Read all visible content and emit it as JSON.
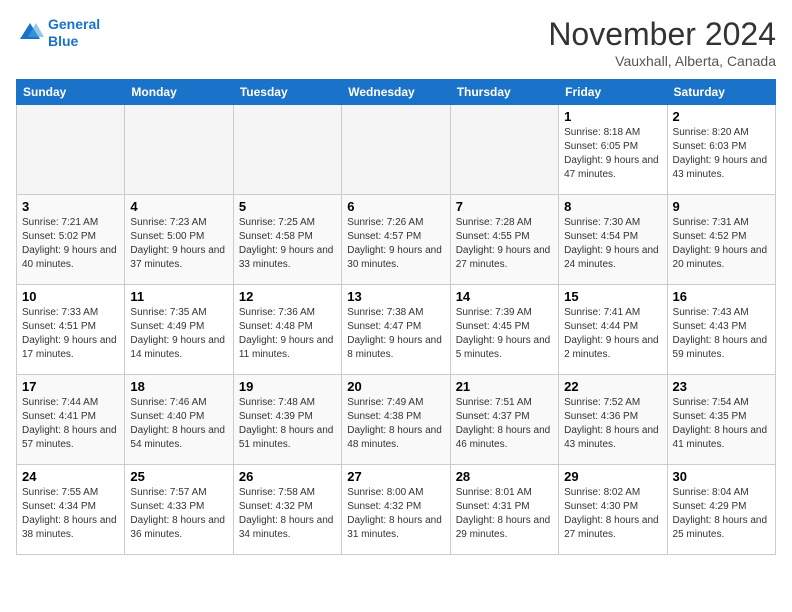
{
  "logo": {
    "line1": "General",
    "line2": "Blue"
  },
  "title": "November 2024",
  "location": "Vauxhall, Alberta, Canada",
  "days_header": [
    "Sunday",
    "Monday",
    "Tuesday",
    "Wednesday",
    "Thursday",
    "Friday",
    "Saturday"
  ],
  "weeks": [
    [
      {
        "day": "",
        "info": ""
      },
      {
        "day": "",
        "info": ""
      },
      {
        "day": "",
        "info": ""
      },
      {
        "day": "",
        "info": ""
      },
      {
        "day": "",
        "info": ""
      },
      {
        "day": "1",
        "info": "Sunrise: 8:18 AM\nSunset: 6:05 PM\nDaylight: 9 hours and 47 minutes."
      },
      {
        "day": "2",
        "info": "Sunrise: 8:20 AM\nSunset: 6:03 PM\nDaylight: 9 hours and 43 minutes."
      }
    ],
    [
      {
        "day": "3",
        "info": "Sunrise: 7:21 AM\nSunset: 5:02 PM\nDaylight: 9 hours and 40 minutes."
      },
      {
        "day": "4",
        "info": "Sunrise: 7:23 AM\nSunset: 5:00 PM\nDaylight: 9 hours and 37 minutes."
      },
      {
        "day": "5",
        "info": "Sunrise: 7:25 AM\nSunset: 4:58 PM\nDaylight: 9 hours and 33 minutes."
      },
      {
        "day": "6",
        "info": "Sunrise: 7:26 AM\nSunset: 4:57 PM\nDaylight: 9 hours and 30 minutes."
      },
      {
        "day": "7",
        "info": "Sunrise: 7:28 AM\nSunset: 4:55 PM\nDaylight: 9 hours and 27 minutes."
      },
      {
        "day": "8",
        "info": "Sunrise: 7:30 AM\nSunset: 4:54 PM\nDaylight: 9 hours and 24 minutes."
      },
      {
        "day": "9",
        "info": "Sunrise: 7:31 AM\nSunset: 4:52 PM\nDaylight: 9 hours and 20 minutes."
      }
    ],
    [
      {
        "day": "10",
        "info": "Sunrise: 7:33 AM\nSunset: 4:51 PM\nDaylight: 9 hours and 17 minutes."
      },
      {
        "day": "11",
        "info": "Sunrise: 7:35 AM\nSunset: 4:49 PM\nDaylight: 9 hours and 14 minutes."
      },
      {
        "day": "12",
        "info": "Sunrise: 7:36 AM\nSunset: 4:48 PM\nDaylight: 9 hours and 11 minutes."
      },
      {
        "day": "13",
        "info": "Sunrise: 7:38 AM\nSunset: 4:47 PM\nDaylight: 9 hours and 8 minutes."
      },
      {
        "day": "14",
        "info": "Sunrise: 7:39 AM\nSunset: 4:45 PM\nDaylight: 9 hours and 5 minutes."
      },
      {
        "day": "15",
        "info": "Sunrise: 7:41 AM\nSunset: 4:44 PM\nDaylight: 9 hours and 2 minutes."
      },
      {
        "day": "16",
        "info": "Sunrise: 7:43 AM\nSunset: 4:43 PM\nDaylight: 8 hours and 59 minutes."
      }
    ],
    [
      {
        "day": "17",
        "info": "Sunrise: 7:44 AM\nSunset: 4:41 PM\nDaylight: 8 hours and 57 minutes."
      },
      {
        "day": "18",
        "info": "Sunrise: 7:46 AM\nSunset: 4:40 PM\nDaylight: 8 hours and 54 minutes."
      },
      {
        "day": "19",
        "info": "Sunrise: 7:48 AM\nSunset: 4:39 PM\nDaylight: 8 hours and 51 minutes."
      },
      {
        "day": "20",
        "info": "Sunrise: 7:49 AM\nSunset: 4:38 PM\nDaylight: 8 hours and 48 minutes."
      },
      {
        "day": "21",
        "info": "Sunrise: 7:51 AM\nSunset: 4:37 PM\nDaylight: 8 hours and 46 minutes."
      },
      {
        "day": "22",
        "info": "Sunrise: 7:52 AM\nSunset: 4:36 PM\nDaylight: 8 hours and 43 minutes."
      },
      {
        "day": "23",
        "info": "Sunrise: 7:54 AM\nSunset: 4:35 PM\nDaylight: 8 hours and 41 minutes."
      }
    ],
    [
      {
        "day": "24",
        "info": "Sunrise: 7:55 AM\nSunset: 4:34 PM\nDaylight: 8 hours and 38 minutes."
      },
      {
        "day": "25",
        "info": "Sunrise: 7:57 AM\nSunset: 4:33 PM\nDaylight: 8 hours and 36 minutes."
      },
      {
        "day": "26",
        "info": "Sunrise: 7:58 AM\nSunset: 4:32 PM\nDaylight: 8 hours and 34 minutes."
      },
      {
        "day": "27",
        "info": "Sunrise: 8:00 AM\nSunset: 4:32 PM\nDaylight: 8 hours and 31 minutes."
      },
      {
        "day": "28",
        "info": "Sunrise: 8:01 AM\nSunset: 4:31 PM\nDaylight: 8 hours and 29 minutes."
      },
      {
        "day": "29",
        "info": "Sunrise: 8:02 AM\nSunset: 4:30 PM\nDaylight: 8 hours and 27 minutes."
      },
      {
        "day": "30",
        "info": "Sunrise: 8:04 AM\nSunset: 4:29 PM\nDaylight: 8 hours and 25 minutes."
      }
    ]
  ]
}
